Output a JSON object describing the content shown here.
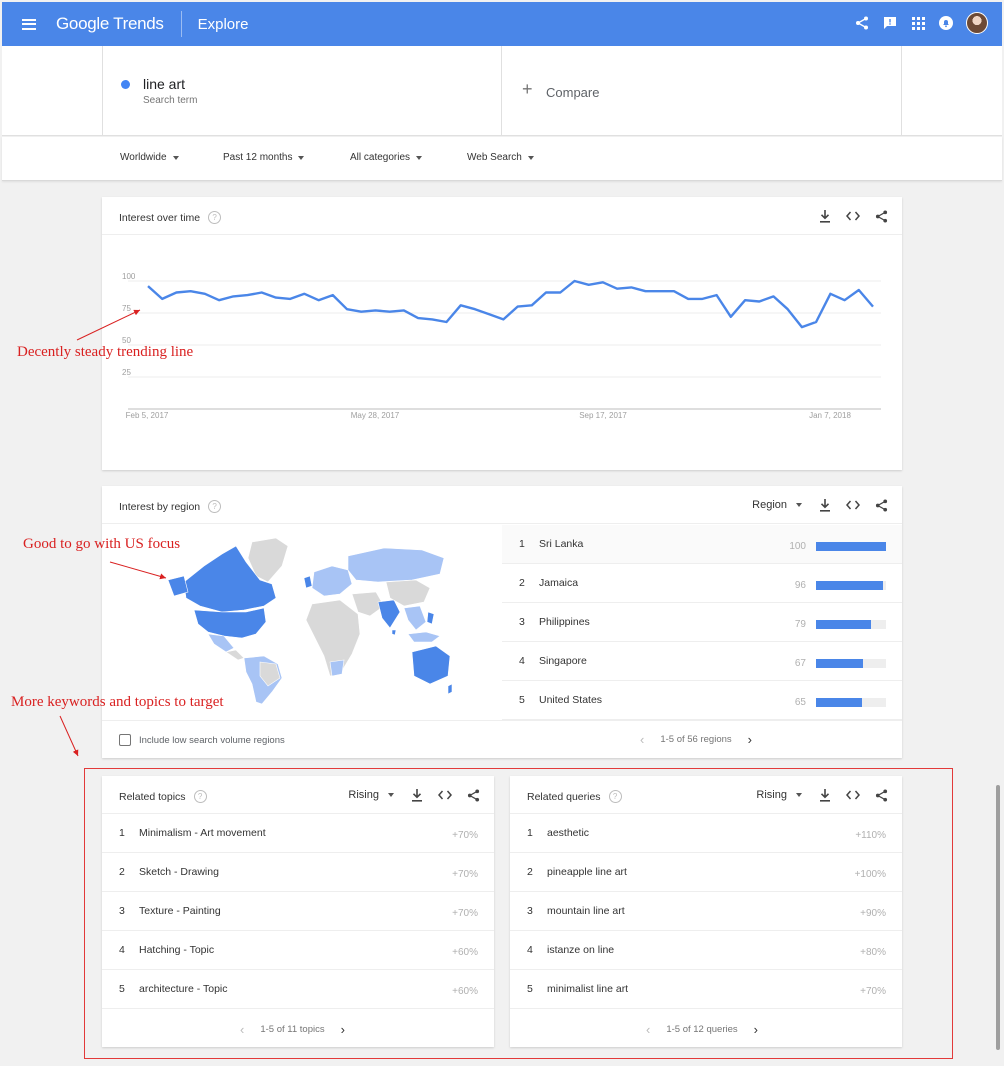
{
  "header": {
    "logo": "Google Trends",
    "nav_title": "Explore"
  },
  "search": {
    "term": "line art",
    "term_sub": "Search term",
    "compare_label": "Compare"
  },
  "filters": [
    "Worldwide",
    "Past 12 months",
    "All categories",
    "Web Search"
  ],
  "interest_over_time": {
    "title": "Interest over time",
    "chart_data": {
      "type": "line",
      "x_tick_labels": [
        "Feb 5, 2017",
        "May 28, 2017",
        "Sep 17, 2017",
        "Jan 7, 2018"
      ],
      "y_tick_labels": [
        "100",
        "75",
        "50",
        "25"
      ],
      "ylim": [
        0,
        100
      ],
      "grid": true,
      "legend": "none",
      "color": "#4a86e8",
      "values": [
        96,
        86,
        91,
        92,
        90,
        85,
        88,
        89,
        91,
        87,
        86,
        90,
        85,
        89,
        78,
        76,
        77,
        76,
        77,
        71,
        70,
        68,
        81,
        78,
        74,
        70,
        80,
        81,
        91,
        91,
        100,
        97,
        99,
        94,
        95,
        92,
        92,
        92,
        86,
        86,
        89,
        72,
        85,
        84,
        88,
        78,
        64,
        68,
        90,
        85,
        93,
        80
      ]
    }
  },
  "interest_by_region": {
    "title": "Interest by region",
    "dropdown": "Region",
    "rows": [
      {
        "rank": "1",
        "label": "Sri Lanka",
        "value": "100"
      },
      {
        "rank": "2",
        "label": "Jamaica",
        "value": "96"
      },
      {
        "rank": "3",
        "label": "Philippines",
        "value": "79"
      },
      {
        "rank": "4",
        "label": "Singapore",
        "value": "67"
      },
      {
        "rank": "5",
        "label": "United States",
        "value": "65"
      }
    ],
    "checkbox_label": "Include low search volume regions",
    "pager": "1-5 of 56 regions"
  },
  "related_topics": {
    "title": "Related topics",
    "dropdown": "Rising",
    "rows": [
      {
        "rank": "1",
        "label": "Minimalism - Art movement",
        "value": "+70%"
      },
      {
        "rank": "2",
        "label": "Sketch - Drawing",
        "value": "+70%"
      },
      {
        "rank": "3",
        "label": "Texture - Painting",
        "value": "+70%"
      },
      {
        "rank": "4",
        "label": "Hatching - Topic",
        "value": "+60%"
      },
      {
        "rank": "5",
        "label": "architecture - Topic",
        "value": "+60%"
      }
    ],
    "pager": "1-5 of 11 topics"
  },
  "related_queries": {
    "title": "Related queries",
    "dropdown": "Rising",
    "rows": [
      {
        "rank": "1",
        "label": "aesthetic",
        "value": "+110%"
      },
      {
        "rank": "2",
        "label": "pineapple line art",
        "value": "+100%"
      },
      {
        "rank": "3",
        "label": "mountain line art",
        "value": "+90%"
      },
      {
        "rank": "4",
        "label": "istanze on line",
        "value": "+80%"
      },
      {
        "rank": "5",
        "label": "minimalist line art",
        "value": "+70%"
      }
    ],
    "pager": "1-5 of 12 queries"
  },
  "annotations": {
    "trend": "Decently steady trending line",
    "region": "Good to go with US focus",
    "keywords": "More keywords and topics to target"
  },
  "colors": {
    "brand": "#4a86e8",
    "annotation": "#d92121",
    "map_dark": "#4a86e8",
    "map_light": "#a8c4f5",
    "map_none": "#d9d9d9"
  },
  "icons": [
    "menu-icon",
    "share-icon",
    "feedback-icon",
    "apps-icon",
    "notifications-icon",
    "download-icon",
    "embed-icon",
    "help-icon"
  ]
}
